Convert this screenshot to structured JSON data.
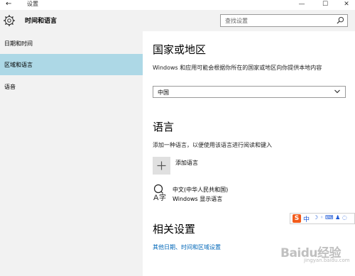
{
  "window": {
    "title": "设置",
    "back_glyph": "←",
    "controls": {
      "minimize": "—",
      "maximize": "☐",
      "close": "✕"
    }
  },
  "header": {
    "title": "时间和语言",
    "icon": "gear-icon",
    "search_placeholder": "查找设置"
  },
  "sidebar": {
    "items": [
      {
        "label": "日期和时间",
        "selected": false
      },
      {
        "label": "区域和语言",
        "selected": true
      },
      {
        "label": "语音",
        "selected": false
      }
    ]
  },
  "region": {
    "heading": "国家或地区",
    "description": "Windows 和应用可能会根据你所在的国家或地区向你提供本地内容",
    "selected_country": "中国"
  },
  "language": {
    "heading": "语言",
    "description": "添加一种语言，以便使用该语言进行阅读和键入",
    "add_button_glyph": "+",
    "add_label": "添加语言",
    "installed": [
      {
        "name": "中文(中华人民共和国)",
        "sub": "Windows 显示语言"
      }
    ]
  },
  "related": {
    "heading": "相关设置",
    "link": "其他日期、时间和区域设置"
  },
  "ime": {
    "logo": "S",
    "mode": "中",
    "rest": "☽ ◦ ⌨ ♟ ◌"
  },
  "watermark": {
    "main": "Baidu经验",
    "sub": "jingyan.baidu.com"
  },
  "colors": {
    "sidebar_bg": "#f2f2f2",
    "selected_bg": "#add8e6",
    "link": "#0067b8",
    "ime_logo": "#f25b1b"
  }
}
